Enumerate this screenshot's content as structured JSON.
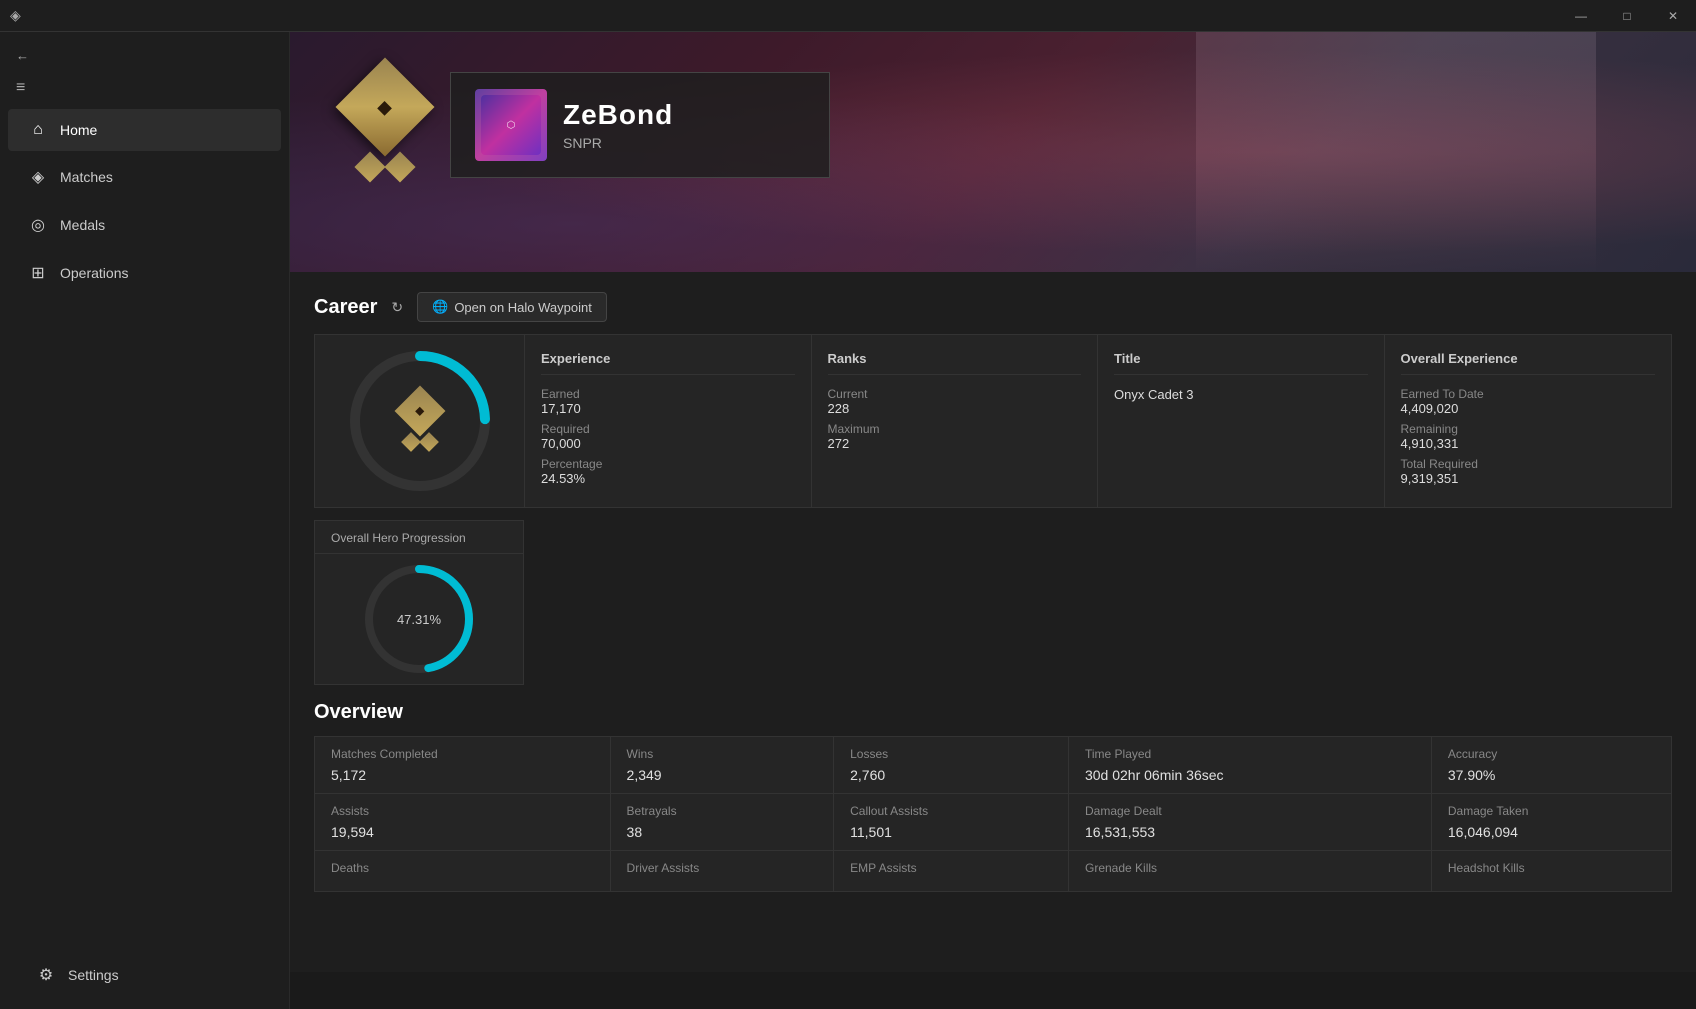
{
  "titlebar": {
    "minimize": "—",
    "maximize": "□",
    "close": "✕"
  },
  "sidebar": {
    "hamburger": "≡",
    "back_icon": "←",
    "items": [
      {
        "id": "home",
        "label": "Home",
        "icon": "⌂",
        "active": true
      },
      {
        "id": "matches",
        "label": "Matches",
        "icon": "◈"
      },
      {
        "id": "medals",
        "label": "Medals",
        "icon": "◎"
      },
      {
        "id": "operations",
        "label": "Operations",
        "icon": "⊞"
      }
    ],
    "settings": {
      "label": "Settings",
      "icon": "⚙"
    }
  },
  "career": {
    "title": "Career",
    "refresh_label": "↻",
    "waypoint_button": "Open on Halo Waypoint",
    "waypoint_icon": "🌐",
    "experience": {
      "header": "Experience",
      "earned_label": "Earned",
      "earned_value": "17,170",
      "required_label": "Required",
      "required_value": "70,000",
      "percentage_label": "Percentage",
      "percentage_value": "24.53%"
    },
    "ranks": {
      "header": "Ranks",
      "current_label": "Current",
      "current_value": "228",
      "maximum_label": "Maximum",
      "maximum_value": "272"
    },
    "title_section": {
      "header": "Title",
      "value": "Onyx Cadet 3"
    },
    "overall_experience": {
      "header": "Overall Experience",
      "earned_label": "Earned To Date",
      "earned_value": "4,409,020",
      "remaining_label": "Remaining",
      "remaining_value": "4,910,331",
      "total_label": "Total Required",
      "total_value": "9,319,351"
    },
    "progress_pct": 24.53,
    "hero_progression": {
      "header": "Overall Hero Progression",
      "percentage": "47.31%",
      "pct_value": 47.31
    }
  },
  "overview": {
    "title": "Overview",
    "rows": [
      {
        "cells": [
          {
            "header": "Matches Completed",
            "value": "5,172"
          },
          {
            "header": "Wins",
            "value": "2,349"
          },
          {
            "header": "Losses",
            "value": "2,760"
          },
          {
            "header": "Time Played",
            "value": "30d 02hr 06min 36sec"
          },
          {
            "header": "Accuracy",
            "value": "37.90%"
          }
        ]
      },
      {
        "cells": [
          {
            "header": "Assists",
            "value": "19,594"
          },
          {
            "header": "Betrayals",
            "value": "38"
          },
          {
            "header": "Callout Assists",
            "value": "11,501"
          },
          {
            "header": "Damage Dealt",
            "value": "16,531,553"
          },
          {
            "header": "Damage Taken",
            "value": "16,046,094"
          }
        ]
      },
      {
        "cells": [
          {
            "header": "Deaths",
            "value": ""
          },
          {
            "header": "Driver Assists",
            "value": ""
          },
          {
            "header": "EMP Assists",
            "value": ""
          },
          {
            "header": "Grenade Kills",
            "value": ""
          },
          {
            "header": "Headshot Kills",
            "value": ""
          }
        ]
      }
    ]
  },
  "player": {
    "name": "ZeBond",
    "tag": "SNPR"
  }
}
